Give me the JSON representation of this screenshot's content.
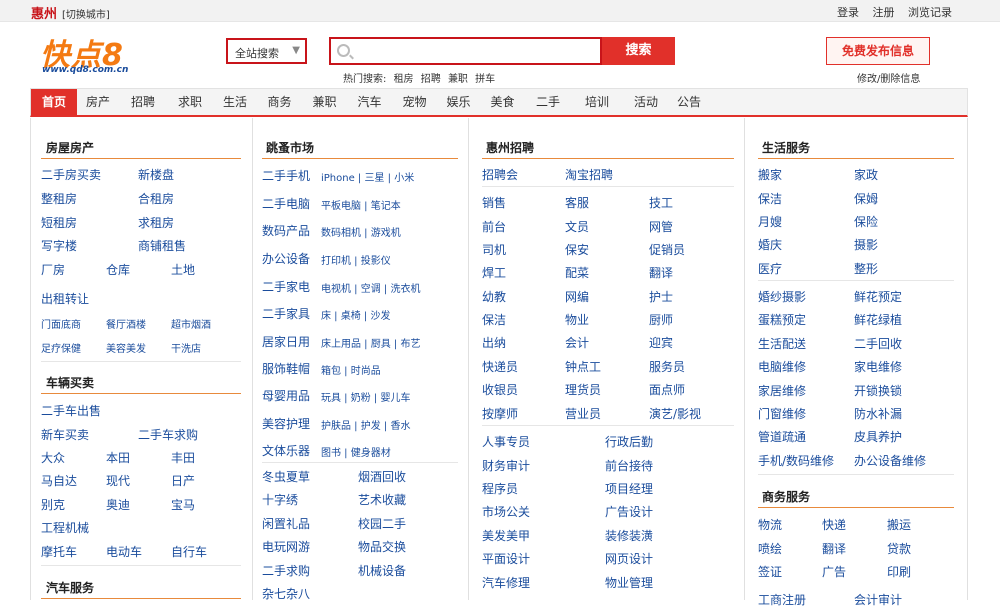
{
  "topbar": {
    "city": "惠州",
    "switch": "[切换城市]",
    "links": [
      "登录",
      "注册",
      "浏览记录"
    ]
  },
  "logo": {
    "text": "快点8",
    "url": "www.qd8.com.cn"
  },
  "search": {
    "select_label": "全站搜索",
    "placeholder": "",
    "button": "搜索",
    "hot_label": "热门搜索:",
    "hot_words": [
      "租房",
      "招聘",
      "兼职",
      "拼车"
    ]
  },
  "post": {
    "button": "免费发布信息",
    "edit": "修改/删除信息"
  },
  "nav": [
    "首页",
    "房产",
    "招聘",
    "求职",
    "生活",
    "商务",
    "兼职",
    "汽车",
    "宠物",
    "娱乐",
    "美食",
    "二手",
    "培训",
    "活动",
    "公告"
  ],
  "col1": {
    "sec1": "房屋房产",
    "links1": [
      "二手房买卖",
      "新楼盘",
      "整租房",
      "合租房",
      "短租房",
      "求租房",
      "写字楼",
      "商铺租售",
      "厂房",
      "仓库",
      "土地",
      "出租转让"
    ],
    "small1": [
      "门面底商",
      "餐厅酒楼",
      "超市烟酒",
      "足疗保健",
      "美容美发",
      "干洗店"
    ],
    "sec2": "车辆买卖",
    "links2": [
      "二手车出售",
      "新车买卖",
      "二手车求购",
      "大众",
      "本田",
      "丰田",
      "马自达",
      "现代",
      "日产",
      "别克",
      "奥迪",
      "宝马",
      "工程机械",
      "摩托车",
      "电动车",
      "自行车"
    ],
    "sec3": "汽车服务"
  },
  "col2": {
    "sec": "跳蚤市场",
    "rows": [
      {
        "main": "二手手机",
        "sub": "iPhone | 三星 | 小米"
      },
      {
        "main": "二手电脑",
        "sub": "平板电脑 | 笔记本"
      },
      {
        "main": "数码产品",
        "sub": "数码相机 | 游戏机"
      },
      {
        "main": "办公设备",
        "sub": "打印机 | 投影仪"
      },
      {
        "main": "二手家电",
        "sub": "电视机 | 空调 | 洗衣机"
      },
      {
        "main": "二手家具",
        "sub": "床 | 桌椅 | 沙发"
      },
      {
        "main": "居家日用",
        "sub": "床上用品 | 厨具 | 布艺"
      },
      {
        "main": "服饰鞋帽",
        "sub": "箱包 | 时尚品"
      },
      {
        "main": "母婴用品",
        "sub": "玩具 | 奶粉 | 婴儿车"
      },
      {
        "main": "美容护理",
        "sub": "护肤品 | 护发 | 香水"
      },
      {
        "main": "文体乐器",
        "sub": "图书 | 健身器材"
      }
    ],
    "pairs": [
      [
        "冬虫夏草",
        "烟酒回收"
      ],
      [
        "十字绣",
        "艺术收藏"
      ],
      [
        "闲置礼品",
        "校园二手"
      ],
      [
        "电玩网游",
        "物品交换"
      ],
      [
        "二手求购",
        "机械设备"
      ],
      [
        "杂七杂八",
        ""
      ]
    ]
  },
  "col3": {
    "sec": "惠州招聘",
    "top": [
      "招聘会",
      "淘宝招聘"
    ],
    "grid": [
      [
        "销售",
        "客服",
        "技工"
      ],
      [
        "前台",
        "文员",
        "网管"
      ],
      [
        "司机",
        "保安",
        "促销员"
      ],
      [
        "焊工",
        "配菜",
        "翻译"
      ],
      [
        "幼教",
        "网编",
        "护士"
      ],
      [
        "保洁",
        "物业",
        "厨师"
      ],
      [
        "出纳",
        "会计",
        "迎宾"
      ],
      [
        "快递员",
        "钟点工",
        "服务员"
      ],
      [
        "收银员",
        "理货员",
        "面点师"
      ],
      [
        "按摩师",
        "营业员",
        "演艺/影视"
      ]
    ],
    "pairs": [
      [
        "人事专员",
        "行政后勤"
      ],
      [
        "财务审计",
        "前台接待"
      ],
      [
        "程序员",
        "项目经理"
      ],
      [
        "市场公关",
        "广告设计"
      ],
      [
        "美发美甲",
        "装修装潢"
      ],
      [
        "平面设计",
        "网页设计"
      ],
      [
        "汽车修理",
        "物业管理"
      ]
    ]
  },
  "col4": {
    "sec1": "生活服务",
    "pairs1": [
      [
        "搬家",
        "家政"
      ],
      [
        "保洁",
        "保姆"
      ],
      [
        "月嫂",
        "保险"
      ],
      [
        "婚庆",
        "摄影"
      ],
      [
        "医疗",
        "整形"
      ]
    ],
    "pairs2": [
      [
        "婚纱摄影",
        "鲜花预定"
      ],
      [
        "蛋糕预定",
        "鲜花绿植"
      ],
      [
        "生活配送",
        "二手回收"
      ],
      [
        "电脑维修",
        "家电维修"
      ],
      [
        "家居维修",
        "开锁换锁"
      ],
      [
        "门窗维修",
        "防水补漏"
      ],
      [
        "管道疏通",
        "皮具养护"
      ],
      [
        "手机/数码维修",
        "办公设备维修"
      ]
    ],
    "sec2": "商务服务",
    "triples": [
      [
        "物流",
        "快递",
        "搬运"
      ],
      [
        "喷绘",
        "翻译",
        "贷款"
      ],
      [
        "签证",
        "广告",
        "印刷"
      ]
    ],
    "bottom": [
      "工商注册",
      "会计审计"
    ]
  }
}
